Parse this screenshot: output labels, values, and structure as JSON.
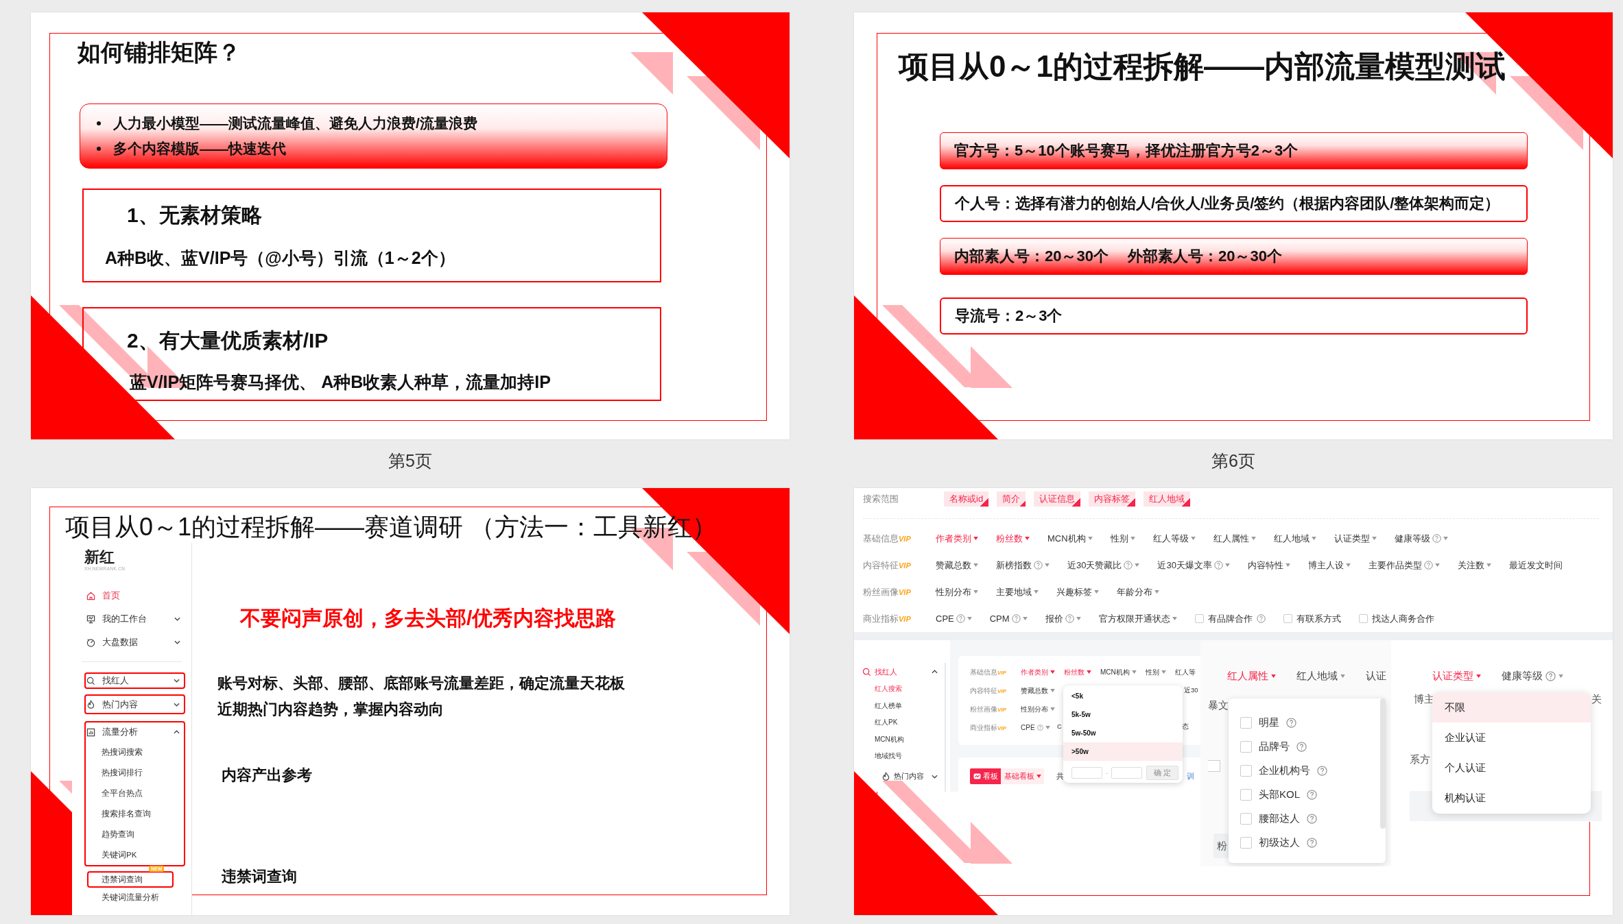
{
  "slides": [
    {
      "kind": "matrix",
      "title": "如何铺排矩阵？",
      "bullets": [
        "人力最小模型——测试流量峰值、避免人力浪费/流量浪费",
        "多个内容模版——快速迭代"
      ],
      "sections": [
        {
          "heading": "1、无素材策略",
          "body": "A种B收、蓝V/IP号（@小号）引流（1～2个）"
        },
        {
          "heading": "2、有大量优质素材/IP",
          "body": "蓝V/IP矩阵号赛马择优、 A种B收素人种草，流量加持IP"
        }
      ],
      "page_label": "第5页"
    },
    {
      "kind": "bars",
      "title": "项目从0～1的过程拆解——内部流量模型测试",
      "bars": [
        {
          "texts": [
            "官方号：5～10个账号赛马，择优注册官方号2～3个"
          ],
          "highlighted": true
        },
        {
          "texts": [
            "个人号：选择有潜力的创始人/合伙人/业务员/签约（根据内容团队/整体架构而定）"
          ],
          "highlighted": false
        },
        {
          "texts": [
            "内部素人号：20～30个",
            "外部素人号：20～30个"
          ],
          "highlighted": true
        },
        {
          "texts": [
            "导流号：2～3个"
          ],
          "highlighted": false
        }
      ],
      "page_label": "第6页"
    },
    {
      "kind": "tool",
      "title": "项目从0～1的过程拆解——赛道调研 （方法一：工具新红）",
      "sidebar": {
        "logo": "新红",
        "logo_caption": "XH.NEWRANK.CN",
        "items": [
          {
            "label": "首页",
            "selected": true
          },
          {
            "label": "我的工作台",
            "selected": false,
            "expanded": false
          },
          {
            "label": "大盘数据",
            "selected": false,
            "expanded": false
          }
        ],
        "tool_items": [
          {
            "label": "找红人",
            "outlined": true,
            "expanded": false
          },
          {
            "label": "热门内容",
            "outlined": true,
            "expanded": false
          },
          {
            "label": "流量分析",
            "outlined": true,
            "expanded": true,
            "children": [
              "热搜词搜索",
              "热搜词排行",
              "全平台热点",
              "搜索排名查询",
              "趋势查询",
              "关键词PK"
            ]
          }
        ],
        "more_items": [
          {
            "label": "违禁词查询",
            "outlined": true,
            "badge": "NEW"
          },
          {
            "label": "关键词流量分析",
            "outlined": false
          }
        ]
      },
      "emphasis": "不要闷声原创，多去头部/优秀内容找思路",
      "points": [
        {
          "lines": [
            "账号对标、头部、腰部、底部账号流量差距，确定流量天花板",
            "近期热门内容趋势，掌握内容动向"
          ]
        },
        {
          "lines": [
            "内容产出参考"
          ]
        },
        {
          "lines": [
            "违禁词查询"
          ]
        }
      ]
    },
    {
      "kind": "filters",
      "search_scope": {
        "label": "搜索范围",
        "tags": [
          "名称或id",
          "简介",
          "认证信息",
          "内容标签",
          "红人地域"
        ]
      },
      "filter_rows": [
        {
          "label": "基础信息",
          "badge": "VIP",
          "items": [
            {
              "text": "作者类别",
              "kind": "dropdown",
              "active": true,
              "help": false
            },
            {
              "text": "粉丝数",
              "kind": "dropdown",
              "active": true,
              "help": false
            },
            {
              "text": "MCN机构",
              "kind": "dropdown",
              "active": false,
              "help": false
            },
            {
              "text": "性别",
              "kind": "dropdown",
              "active": false,
              "help": false
            },
            {
              "text": "红人等级",
              "kind": "dropdown",
              "active": false,
              "help": false
            },
            {
              "text": "红人属性",
              "kind": "dropdown",
              "active": false,
              "help": false
            },
            {
              "text": "红人地域",
              "kind": "dropdown",
              "active": false,
              "help": false
            },
            {
              "text": "认证类型",
              "kind": "dropdown",
              "active": false,
              "help": false
            },
            {
              "text": "健康等级",
              "kind": "dropdown",
              "active": false,
              "help": true
            }
          ]
        },
        {
          "label": "内容特征",
          "badge": "VIP",
          "items": [
            {
              "text": "赞藏总数",
              "kind": "dropdown",
              "active": false,
              "help": false
            },
            {
              "text": "新榜指数",
              "kind": "dropdown",
              "active": false,
              "help": true
            },
            {
              "text": "近30天赞藏比",
              "kind": "dropdown",
              "active": false,
              "help": true
            },
            {
              "text": "近30天爆文率",
              "kind": "dropdown",
              "active": false,
              "help": true
            },
            {
              "text": "内容特性",
              "kind": "dropdown",
              "active": false,
              "help": false
            },
            {
              "text": "博主人设",
              "kind": "dropdown",
              "active": false,
              "help": false
            },
            {
              "text": "主要作品类型",
              "kind": "dropdown",
              "active": false,
              "help": true
            },
            {
              "text": "关注数",
              "kind": "dropdown",
              "active": false,
              "help": false
            },
            {
              "text": "最近发文时间",
              "kind": "dropdown",
              "active": false,
              "help": false,
              "caret": false
            }
          ]
        },
        {
          "label": "粉丝画像",
          "badge": "VIP",
          "items": [
            {
              "text": "性别分布",
              "kind": "dropdown",
              "active": false,
              "help": false
            },
            {
              "text": "主要地域",
              "kind": "dropdown",
              "active": false,
              "help": false
            },
            {
              "text": "兴趣标签",
              "kind": "dropdown",
              "active": false,
              "help": false
            },
            {
              "text": "年龄分布",
              "kind": "dropdown",
              "active": false,
              "help": false
            }
          ]
        },
        {
          "label": "商业指标",
          "badge": "VIP",
          "items": [
            {
              "text": "CPE",
              "kind": "dropdown",
              "active": false,
              "help": true
            },
            {
              "text": "CPM",
              "kind": "dropdown",
              "active": false,
              "help": true
            },
            {
              "text": "报价",
              "kind": "dropdown",
              "active": false,
              "help": true
            },
            {
              "text": "官方权限开通状态",
              "kind": "dropdown",
              "active": false,
              "help": false
            },
            {
              "text": "有品牌合作",
              "kind": "checkbox",
              "checked": false,
              "help": true
            },
            {
              "text": "有联系方式",
              "kind": "checkbox",
              "checked": false,
              "help": false
            },
            {
              "text": "找达人商务合作",
              "kind": "checkbox",
              "checked": false,
              "help": false
            }
          ]
        }
      ],
      "finder": {
        "sidebar": {
          "label": "找红人",
          "expanded": true,
          "children": [
            {
              "label": "红人搜索",
              "selected": true
            },
            {
              "label": "红人榜单",
              "selected": false
            },
            {
              "label": "红人PK",
              "selected": false
            },
            {
              "label": "MCN机构",
              "selected": false
            },
            {
              "label": "地域找号",
              "selected": false
            }
          ],
          "next": {
            "label": "热门内容",
            "expanded": false
          }
        },
        "rows": [
          {
            "label": "基础信息",
            "badge": "VIP",
            "items": [
              {
                "text": "作者类别",
                "active": true,
                "help": false
              },
              {
                "text": "粉丝数",
                "active": true,
                "help": false
              },
              {
                "text": "MCN机构",
                "active": false,
                "help": false
              },
              {
                "text": "性别",
                "active": false,
                "help": false
              },
              {
                "text": "红人等",
                "active": false,
                "help": false,
                "caret": false
              }
            ]
          },
          {
            "label": "内容特征",
            "badge": "VIP",
            "items": [
              {
                "text": "赞藏总数",
                "active": false,
                "help": false
              }
            ]
          },
          {
            "label": "粉丝画像",
            "badge": "VIP",
            "items": [
              {
                "text": "性别分布",
                "active": false,
                "help": false
              }
            ]
          },
          {
            "label": "商业指标",
            "badge": "VIP",
            "items": [
              {
                "text": "CPE",
                "active": false,
                "help": true
              }
            ]
          }
        ],
        "fragments": [
          "近30",
          "C",
          "态"
        ],
        "dropdown": {
          "options": [
            {
              "text": "<5k",
              "selected": false
            },
            {
              "text": "5k-5w",
              "selected": false
            },
            {
              "text": "5w-50w",
              "selected": false
            },
            {
              "text": ">50w",
              "selected": true
            }
          ],
          "range_separator": "-",
          "confirm": {
            "text": "确 定",
            "disabled": true
          }
        },
        "board": {
          "tab": "看板",
          "view": "基础看板",
          "count": "共",
          "link": "训"
        }
      },
      "attribute_panel": {
        "headers": [
          {
            "text": "红人属性",
            "active": true,
            "caret": true
          },
          {
            "text": "红人地域",
            "active": false,
            "caret": true
          },
          {
            "text": "认证",
            "active": false,
            "caret": false
          }
        ],
        "fragments": [
          "暴文",
          "粉"
        ],
        "options": [
          {
            "text": "明星",
            "checked": false,
            "help": true
          },
          {
            "text": "品牌号",
            "checked": false,
            "help": true
          },
          {
            "text": "企业机构号",
            "checked": false,
            "help": true
          },
          {
            "text": "头部KOL",
            "checked": false,
            "help": true
          },
          {
            "text": "腰部达人",
            "checked": false,
            "help": true
          },
          {
            "text": "初级达人",
            "checked": false,
            "help": true
          }
        ]
      },
      "cert_panel": {
        "headers": [
          {
            "text": "认证类型",
            "active": true,
            "help": false
          },
          {
            "text": "健康等级",
            "active": false,
            "help": true
          }
        ],
        "fragments": [
          "博主",
          "关",
          "系方"
        ],
        "options": [
          {
            "text": "不限",
            "selected": true
          },
          {
            "text": "企业认证",
            "selected": false
          },
          {
            "text": "个人认证",
            "selected": false
          },
          {
            "text": "机构认证",
            "selected": false
          }
        ]
      }
    }
  ]
}
